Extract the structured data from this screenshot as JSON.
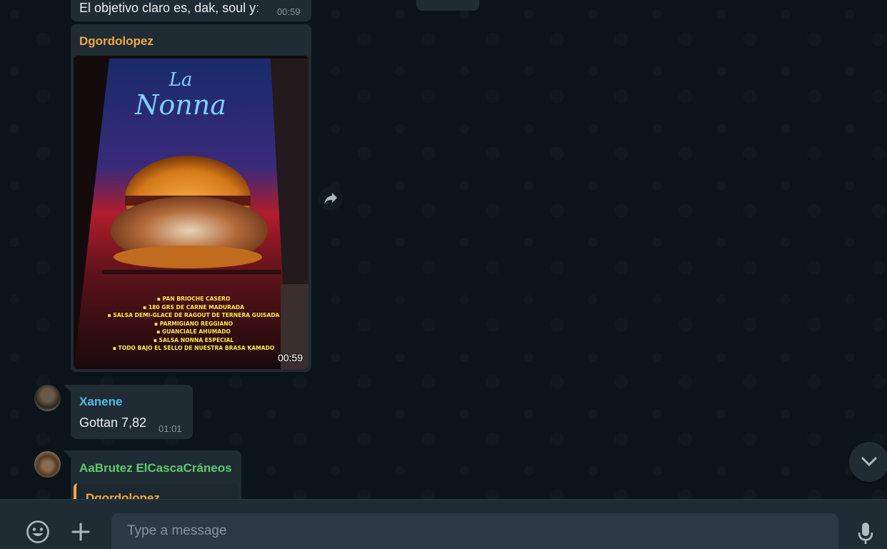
{
  "messages": [
    {
      "text": "El objetivo claro es, dak, soul y:",
      "time": "00:59"
    },
    {
      "sender": "Dgordolopez",
      "time": "00:59",
      "image": {
        "title_line1": "La",
        "title_line2": "Nonna",
        "menu": [
          "▪ PAN BRIOCHE CASERO",
          "▪ 180 GRS DE CARNE MADURADA",
          "▪ SALSA DEMI-GLACE DE RAGOUT DE TERNERA GUISADA",
          "▪ PARMIGIANO REGGIANO",
          "▪ GUANCIALE AHUMADO",
          "▪ SALSA NONNA ESPECIAL",
          "▪ TODO BAJO EL SELLO DE NUESTRA BRASA KAMADO"
        ]
      }
    },
    {
      "sender": "Xanene",
      "text": "Gottan 7,82",
      "time": "01:01"
    },
    {
      "sender": "AaBrutez ElCascaCráneos",
      "quoted_sender": "Dgordolopez"
    }
  ],
  "composer": {
    "placeholder": "Type a message"
  },
  "colors": {
    "bg": "#0b141a",
    "bubble": "#202c33",
    "orange": "#f5a742",
    "blue": "#53bdeb",
    "green": "#5fca6f"
  }
}
